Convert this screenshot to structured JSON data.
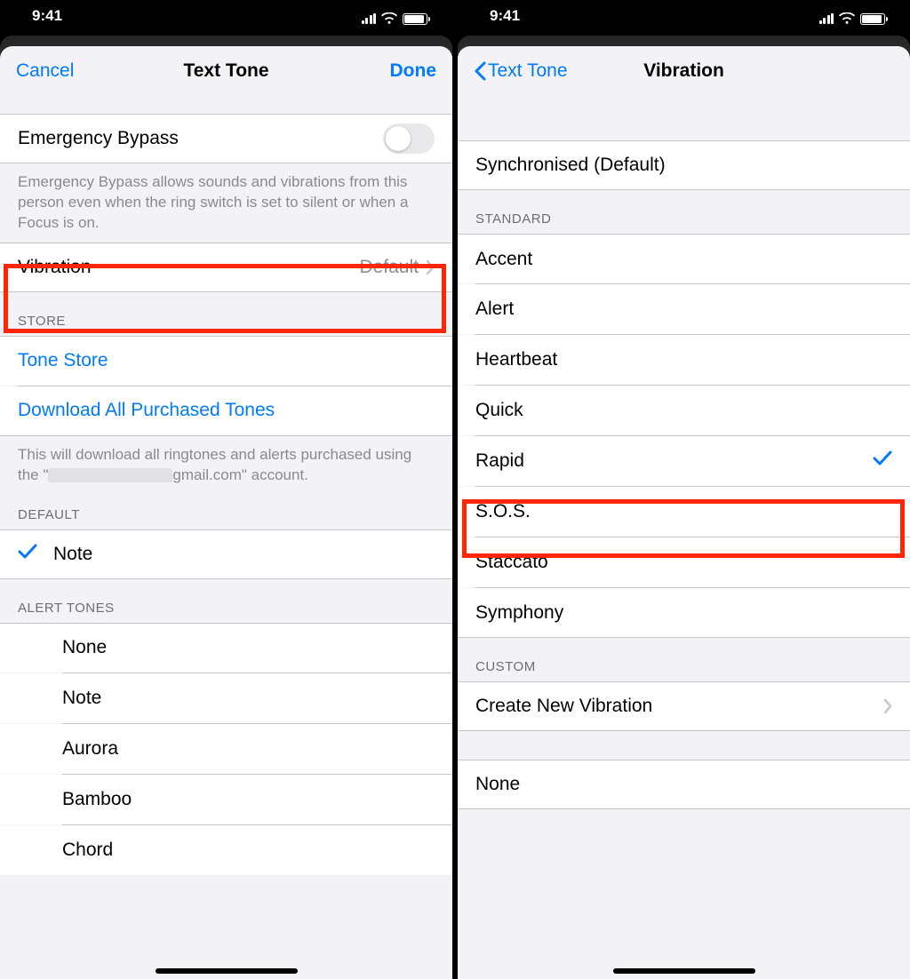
{
  "status": {
    "time": "9:41"
  },
  "left": {
    "nav": {
      "cancel": "Cancel",
      "title": "Text Tone",
      "done": "Done"
    },
    "emergency": {
      "label": "Emergency Bypass",
      "footer": "Emergency Bypass allows sounds and vibrations from this person even when the ring switch is set to silent or when a Focus is on."
    },
    "vibration": {
      "label": "Vibration",
      "value": "Default"
    },
    "store": {
      "header": "STORE",
      "tone_store": "Tone Store",
      "download_all": "Download All Purchased Tones",
      "footer_pre": "This will download all ringtones and alerts purchased using the \"",
      "footer_post": "gmail.com\" account."
    },
    "default_section": {
      "header": "DEFAULT",
      "selected": "Note"
    },
    "alert_tones": {
      "header": "ALERT TONES",
      "items": [
        "None",
        "Note",
        "Aurora",
        "Bamboo",
        "Chord"
      ]
    }
  },
  "right": {
    "nav": {
      "back": "Text Tone",
      "title": "Vibration"
    },
    "sync": {
      "label": "Synchronised (Default)"
    },
    "standard": {
      "header": "STANDARD",
      "items": [
        "Accent",
        "Alert",
        "Heartbeat",
        "Quick",
        "Rapid",
        "S.O.S.",
        "Staccato",
        "Symphony"
      ],
      "selected": "Rapid"
    },
    "custom": {
      "header": "CUSTOM",
      "create": "Create New Vibration",
      "none": "None"
    }
  }
}
